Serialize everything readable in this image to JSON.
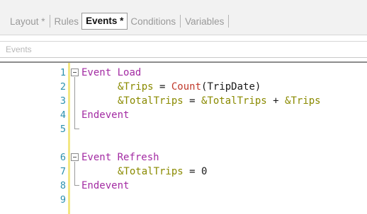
{
  "tabs": [
    {
      "label": "Layout *"
    },
    {
      "label": "Rules"
    },
    {
      "label": "Events *"
    },
    {
      "label": "Conditions"
    },
    {
      "label": "Variables"
    }
  ],
  "active_tab": "Events *",
  "events_selector": {
    "placeholder": "Events"
  },
  "editor": {
    "line_numbers": [
      "1",
      "2",
      "3",
      "4",
      "5",
      "6",
      "7",
      "8",
      "9"
    ],
    "lines": {
      "l1": {
        "kw": "Event",
        "name": " Load"
      },
      "l2": {
        "var": "&Trips",
        "op": " = ",
        "fn": "Count",
        "arg": "(TripDate)"
      },
      "l3": {
        "var1": "&TotalTrips",
        "op1": " = ",
        "var2": "&TotalTrips",
        "op2": " + ",
        "var3": "&Trips"
      },
      "l4": {
        "kw": "Endevent"
      },
      "l6": {
        "kw": "Event",
        "name": " Refresh"
      },
      "l7": {
        "var": "&TotalTrips",
        "op": " = ",
        "num": "0"
      },
      "l8": {
        "kw": "Endevent"
      }
    }
  },
  "colors": {
    "keyword": "#a32ba3",
    "variable": "#8a8a00",
    "function": "#c0392b",
    "line_number": "#2b91af",
    "change_marker": "#f2e783"
  }
}
